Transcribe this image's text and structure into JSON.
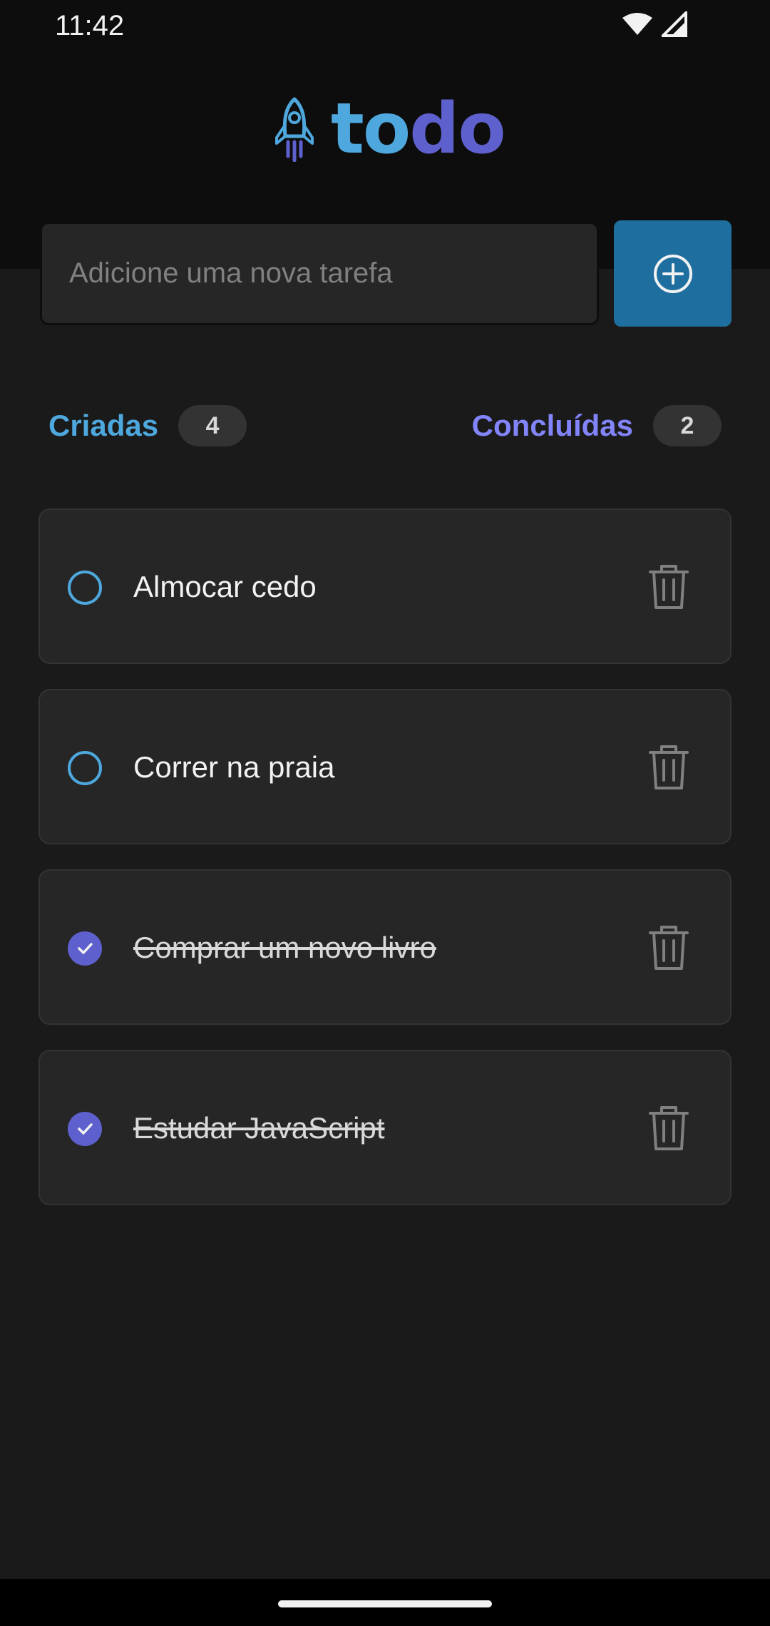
{
  "status_bar": {
    "time": "11:42",
    "icons": [
      "wifi-icon",
      "cell-signal-icon"
    ]
  },
  "app": {
    "logo_part1": "to",
    "logo_part2": "do",
    "colors": {
      "blue": "#4ea8de",
      "purple": "#5e60ce",
      "purple_light": "#8284fa",
      "button": "#1e6f9f"
    }
  },
  "new_task": {
    "placeholder": "Adicione uma nova tarefa",
    "value": "",
    "add_icon": "plus-circle-icon"
  },
  "counters": {
    "created_label": "Criadas",
    "created_count": "4",
    "done_label": "Concluídas",
    "done_count": "2"
  },
  "tasks": [
    {
      "text": "Almocar cedo",
      "done": false
    },
    {
      "text": "Correr na praia",
      "done": false
    },
    {
      "text": "Comprar um novo livro",
      "done": true
    },
    {
      "text": "Estudar JavaScript",
      "done": true
    }
  ]
}
